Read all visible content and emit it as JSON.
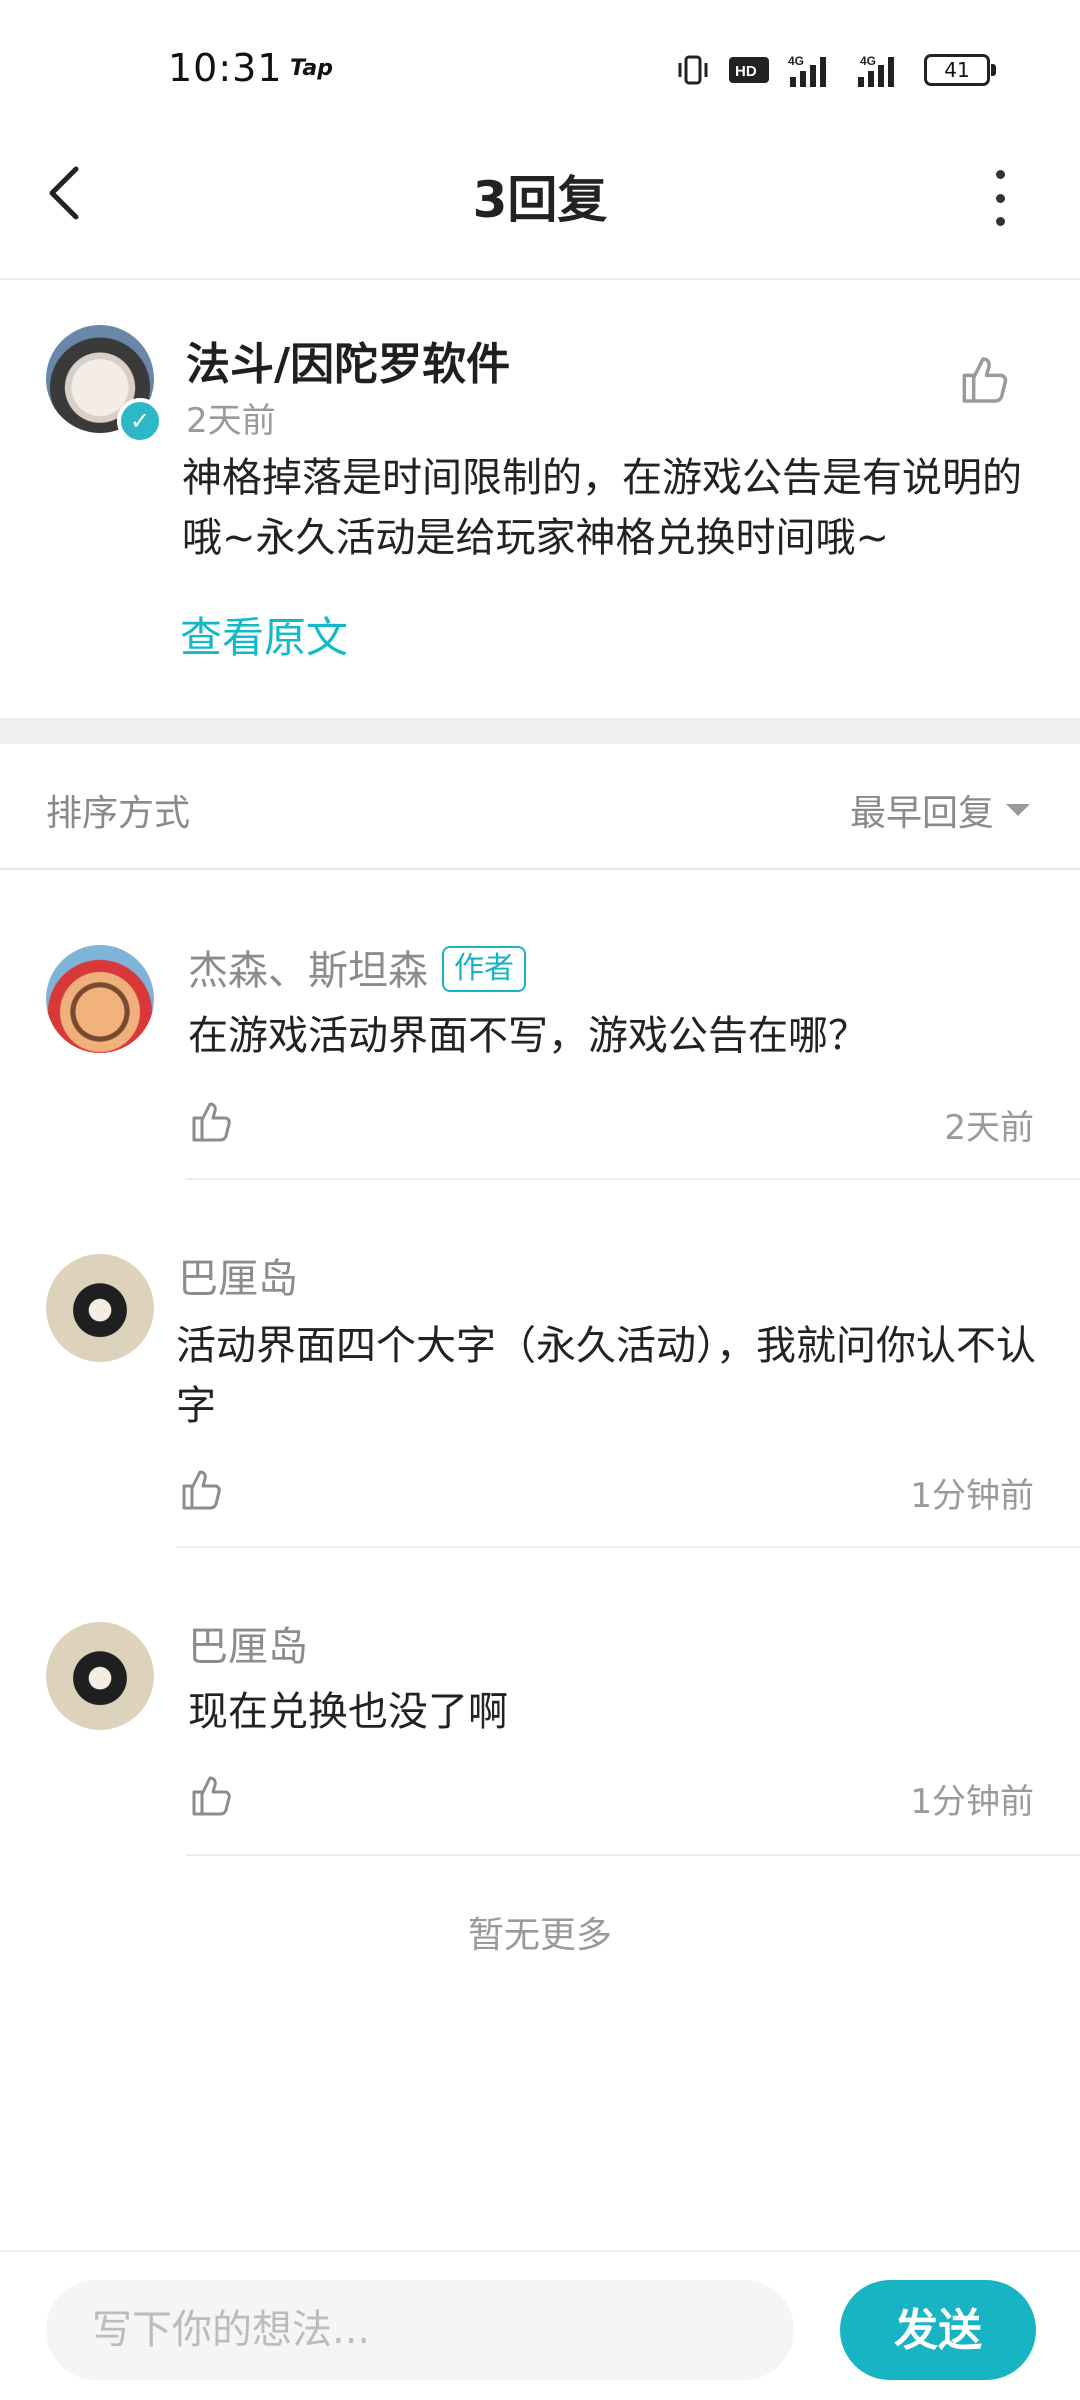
{
  "status_bar": {
    "time": "10:31",
    "app_badge": "Tap",
    "battery": "41"
  },
  "header": {
    "title": "3回复"
  },
  "post": {
    "author": "法斗/因陀罗软件",
    "time": "2天前",
    "content": "神格掉落是时间限制的，在游戏公告是有说明的哦~永久活动是给玩家神格兑换时间哦~",
    "view_original_label": "查看原文"
  },
  "sort": {
    "label": "排序方式",
    "value": "最早回复"
  },
  "replies": [
    {
      "name": "杰森、斯坦森",
      "tag": "作者",
      "text": "在游戏活动界面不写，游戏公告在哪？",
      "time": "2天前"
    },
    {
      "name": "巴厘岛",
      "tag": "",
      "text": "活动界面四个大字（永久活动），我就问你认不认字",
      "time": "1分钟前"
    },
    {
      "name": "巴厘岛",
      "tag": "",
      "text": "现在兑换也没了啊",
      "time": "1分钟前"
    }
  ],
  "footer_note": "暂无更多",
  "composer": {
    "placeholder": "写下你的想法...",
    "send_label": "发送"
  },
  "colors": {
    "accent": "#19b4c3",
    "muted_text": "#9a9a9a"
  }
}
